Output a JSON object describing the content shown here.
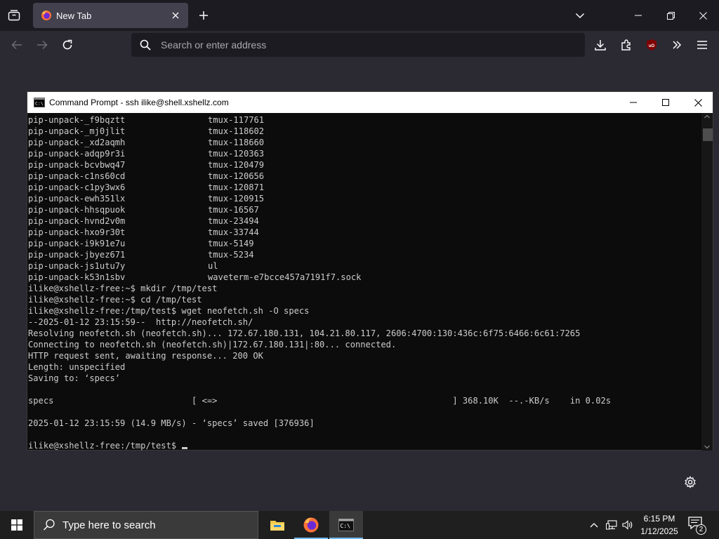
{
  "browser": {
    "tab": {
      "title": "New Tab"
    },
    "urlbar": {
      "placeholder": "Search or enter address"
    },
    "icons": {
      "tab_list": "tab-list-icon",
      "new_tab": "plus-icon",
      "tab_overflow": "chevron-down-icon",
      "back": "arrow-left-icon",
      "forward": "arrow-right-icon",
      "reload": "reload-icon",
      "downloads": "download-icon",
      "extensions": "puzzle-icon",
      "ublock": "ublock-origin-icon",
      "overflow_menu": "double-chevron-icon",
      "app_menu": "hamburger-icon"
    },
    "colors": {
      "tabstrip": "#1c1b22",
      "toolbar": "#2b2a33",
      "active_tab": "#42414d"
    }
  },
  "cmd": {
    "title": "Command Prompt - ssh  ilike@shell.xshellz.com",
    "listing": [
      [
        "pip-unpack-_f9bqztt",
        "tmux-117761"
      ],
      [
        "pip-unpack-_mj0jlit",
        "tmux-118602"
      ],
      [
        "pip-unpack-_xd2aqmh",
        "tmux-118660"
      ],
      [
        "pip-unpack-adqp9r3i",
        "tmux-120363"
      ],
      [
        "pip-unpack-bcvbwq47",
        "tmux-120479"
      ],
      [
        "pip-unpack-c1ns60cd",
        "tmux-120656"
      ],
      [
        "pip-unpack-c1py3wx6",
        "tmux-120871"
      ],
      [
        "pip-unpack-ewh351lx",
        "tmux-120915"
      ],
      [
        "pip-unpack-hhsqpuok",
        "tmux-16567"
      ],
      [
        "pip-unpack-hvnd2v0m",
        "tmux-23494"
      ],
      [
        "pip-unpack-hxo9r30t",
        "tmux-33744"
      ],
      [
        "pip-unpack-i9k91e7u",
        "tmux-5149"
      ],
      [
        "pip-unpack-jbyez671",
        "tmux-5234"
      ],
      [
        "pip-unpack-js1utu7y",
        "ul"
      ],
      [
        "pip-unpack-k53n1sbv",
        "waveterm-e7bcce457a7191f7.sock"
      ]
    ],
    "output": [
      "ilike@xshellz-free:~$ mkdir /tmp/test",
      "ilike@xshellz-free:~$ cd /tmp/test",
      "ilike@xshellz-free:/tmp/test$ wget neofetch.sh -O specs",
      "--2025-01-12 23:15:59--  http://neofetch.sh/",
      "Resolving neofetch.sh (neofetch.sh)... 172.67.180.131, 104.21.80.117, 2606:4700:130:436c:6f75:6466:6c61:7265",
      "Connecting to neofetch.sh (neofetch.sh)|172.67.180.131|:80... connected.",
      "HTTP request sent, awaiting response... 200 OK",
      "Length: unspecified",
      "Saving to: ‘specs’",
      "",
      "specs                           [ <=>                                              ] 368.10K  --.-KB/s    in 0.02s",
      "",
      "2025-01-12 23:15:59 (14.9 MB/s) - ‘specs’ saved [376936]",
      ""
    ],
    "prompt": "ilike@xshellz-free:/tmp/test$",
    "colors": {
      "background": "#0c0c0c",
      "text": "#cccccc"
    }
  },
  "taskbar": {
    "search_placeholder": "Type here to search",
    "apps": [
      "file-explorer-icon",
      "firefox-icon",
      "command-prompt-icon"
    ],
    "tray_icons": [
      "chevron-up-icon",
      "network-icon",
      "volume-icon"
    ],
    "time": "6:15 PM",
    "date": "1/12/2025",
    "notification_count": "2",
    "colors": {
      "background": "#1f1f1f",
      "accent": "#76b9ed"
    }
  }
}
